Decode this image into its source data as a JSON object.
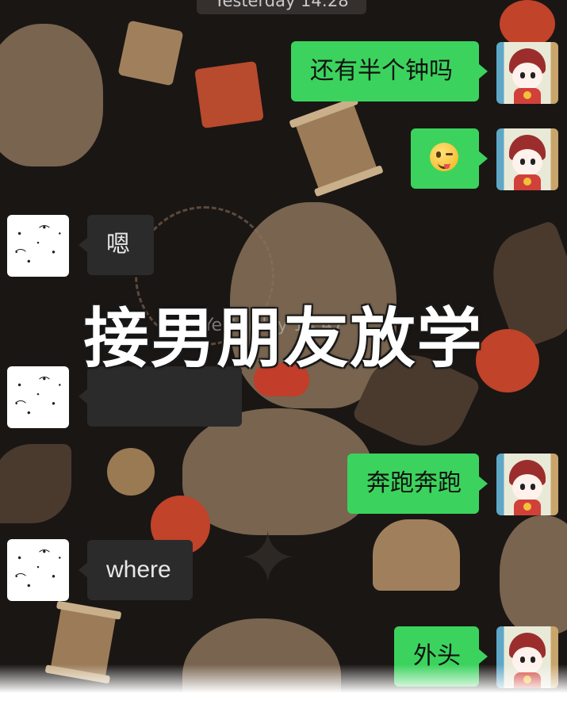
{
  "chat": {
    "top_timestamp": "Yesterday 14:28",
    "mid_timestamp": "Yesterday 14:47",
    "messages": [
      {
        "sender": "me",
        "text": "还有半个钟吗"
      },
      {
        "sender": "me",
        "emoji": "winking-face-with-tongue"
      },
      {
        "sender": "other",
        "text": "嗯"
      },
      {
        "sender": "other",
        "text": "",
        "blurred": true
      },
      {
        "sender": "me",
        "text": "奔跑奔跑"
      },
      {
        "sender": "other",
        "text": "where"
      },
      {
        "sender": "me",
        "text": "外头"
      }
    ]
  },
  "overlay": {
    "caption": "接男朋友放学"
  },
  "colors": {
    "my_bubble": "#3bd35d",
    "other_bubble": "#2b2b2b",
    "background": "#1a1614"
  }
}
